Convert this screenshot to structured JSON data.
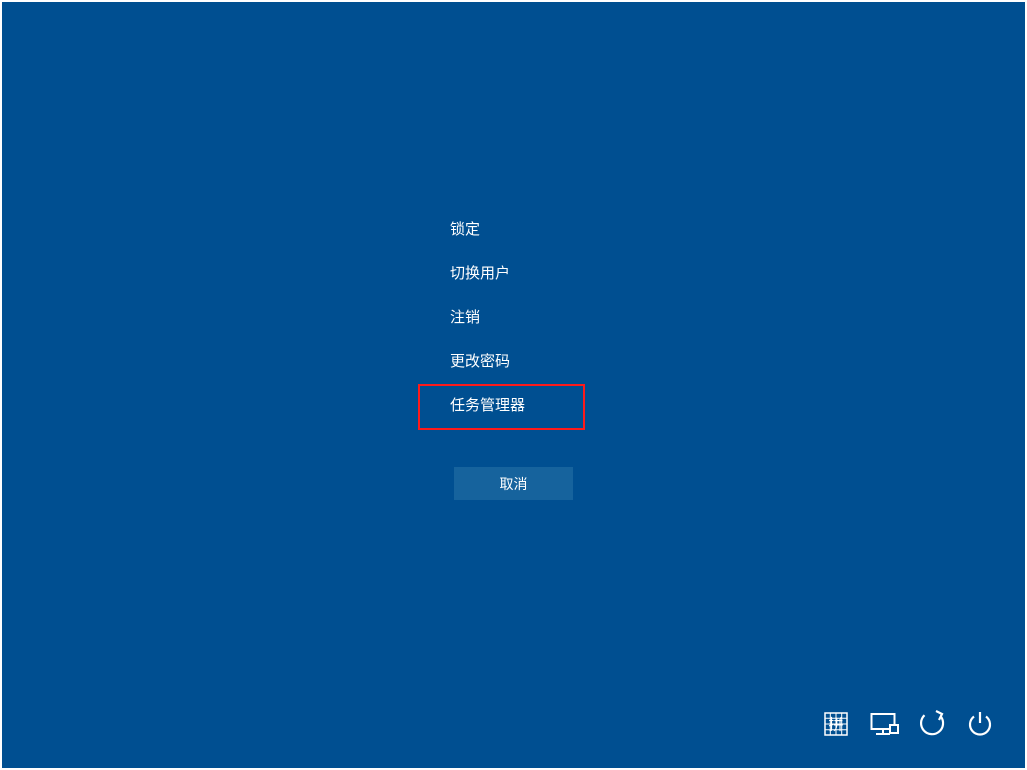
{
  "menu": {
    "items": [
      {
        "label": "锁定"
      },
      {
        "label": "切换用户"
      },
      {
        "label": "注销"
      },
      {
        "label": "更改密码"
      },
      {
        "label": "任务管理器"
      }
    ]
  },
  "cancel_label": "取消",
  "tray": {
    "ime_label": "拼"
  },
  "colors": {
    "background": "#004f91",
    "button_bg": "#16639d",
    "highlight": "#ff1a1a"
  }
}
